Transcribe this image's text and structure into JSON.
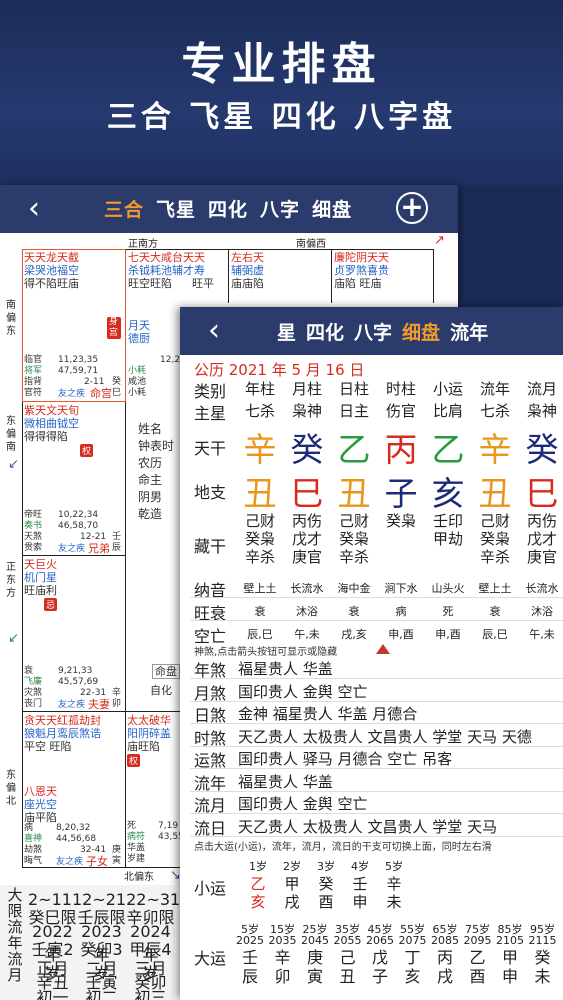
{
  "hero": {
    "title": "专业排盘",
    "subtitle": "三合 飞星 四化 八字盘"
  },
  "screen1": {
    "back": "‹",
    "tabs": [
      "三合",
      "飞星",
      "四化",
      "八字",
      "细盘"
    ],
    "plus": "+",
    "dirs": {
      "top_left": "正南方",
      "top_right": "南偏西",
      "left1": "南偏东",
      "left2": "东偏南",
      "left3": "正东方",
      "left4": "东偏北",
      "bottom": "北偏东"
    },
    "cell_a": {
      "stars_red": "天天龙天截",
      "stars_blue": "梁哭池福空",
      "status": "得不陷旺庙",
      "badge": "身宫",
      "r1": "临官",
      "r1n": "11,23,35",
      "r2": "将军",
      "r2n": "47,59,71",
      "r3": "指背",
      "r3n": "2-11",
      "r4": "官符",
      "r4n": "友之疾",
      "palace": "命宫",
      "gz": "癸巳"
    },
    "cell_b": {
      "stars_red": "七天大咸台天天",
      "stars_blue": "杀钺耗池辅才寿",
      "status": "旺空旺陷",
      "status2": "旺平",
      "mid1": "月天",
      "mid2": "德厨",
      "r1": "12,24",
      "r2": "小耗",
      "r3": "咸池",
      "r4": "小耗"
    },
    "cell_c": {
      "stars_red": "左右天",
      "stars_blue": "辅弼虚",
      "status": "庙庙陷"
    },
    "cell_d": {
      "stars_red": "廉陀阴天天",
      "stars_blue": "贞罗煞喜贵",
      "status": "庙陷  旺庙"
    },
    "cell_e": {
      "stars_red": "紫天文天旬",
      "stars_blue": "微相曲钺空",
      "status": "得得得陷",
      "badge": "权",
      "r1": "帝旺",
      "r1n": "10,22,34",
      "r2": "奏书",
      "r2n": "46,58,70",
      "r3": "天煞",
      "r3n": "12-21",
      "r4": "贯索",
      "r4n": "友之疾",
      "palace": "兄弟",
      "gz": "壬辰"
    },
    "cell_f": {
      "stars_red": "天巨火",
      "stars_blue": "机门星",
      "status": "旺庙利",
      "badge": "忌",
      "r1": "衰",
      "r1n": "9,21,33",
      "r2": "飞廉",
      "r2n": "45,57,69",
      "r3": "灾煞",
      "r3n": "22-31",
      "r4": "丧门",
      "r4n": "友之疾",
      "palace": "夫妻",
      "gz": "辛卯"
    },
    "cell_g": {
      "stars_red": "贪天天红孤劫封",
      "stars_blue": "狼魁月鸾辰煞诰",
      "status": "平空  旺陷"
    },
    "cell_h": {
      "stars_red": "太太破华",
      "stars_blue": "阳阴碎盖",
      "status": "庙旺陷",
      "badge": "权",
      "r1": "死",
      "r1n": "7,19",
      "r2": "病符",
      "r2n": "43,55",
      "r3": "华盖",
      "r4": "岁建"
    },
    "cell_i": {
      "stars_red": "八恩天",
      "stars_blue": "座光空",
      "status": "庙平陷",
      "r1": "病",
      "r1n": "8,20,32",
      "r2": "喜神",
      "r2n": "44,56,68",
      "r3": "劫煞",
      "r3n": "32-41",
      "r4": "晦气",
      "r4n": "友之疾",
      "palace": "子女",
      "gz": "庚寅"
    },
    "center": {
      "l1": "姓名",
      "l2": "钟表时",
      "l3": "农历",
      "l4": "命主",
      "l5": "阴男",
      "l6": "乾造",
      "l7": "命盘",
      "l8": "自化"
    },
    "bottom_label": [
      "大",
      "限",
      "流",
      "年",
      "流",
      "月"
    ],
    "bottom_rows": [
      [
        "2~11",
        "12~21",
        "22~31"
      ],
      [
        "癸巳限",
        "壬辰限",
        "辛卯限"
      ],
      [
        "2022年",
        "2023年",
        "2024年"
      ],
      [
        "壬寅2岁",
        "癸卯3岁",
        "甲辰4岁"
      ],
      [
        "正月",
        "二月",
        "三月"
      ],
      [
        "辛丑",
        "壬寅",
        "癸卯"
      ],
      [
        "初一",
        "初二",
        "初三"
      ]
    ]
  },
  "screen2": {
    "back": "‹",
    "tabs": [
      "星",
      "四化",
      "八字",
      "细盘",
      "流年"
    ],
    "date": "公历 2021 年 5 月 16 日",
    "header_row": {
      "label": "类别",
      "cols": [
        "年柱",
        "月柱",
        "日柱",
        "时柱",
        "小运",
        "流年",
        "流月"
      ]
    },
    "zhuxing_row": {
      "label": "主星",
      "cols": [
        "七杀",
        "枭神",
        "日主",
        "伤官",
        "比肩",
        "七杀",
        "枭神"
      ]
    },
    "tiangan": {
      "label": "天干",
      "chars": [
        "辛",
        "癸",
        "乙",
        "丙",
        "乙",
        "辛",
        "癸"
      ],
      "colors": [
        "#e8961c",
        "#1c2a7a",
        "#2a9a3e",
        "#d62b1e",
        "#2a9a3e",
        "#e8961c",
        "#1c2a7a"
      ]
    },
    "dizhi": {
      "label": "地支",
      "chars": [
        "丑",
        "巳",
        "丑",
        "子",
        "亥",
        "丑",
        "巳"
      ],
      "colors": [
        "#e8961c",
        "#d62b1e",
        "#e8961c",
        "#1c2a7a",
        "#1c2a7a",
        "#e8961c",
        "#d62b1e"
      ]
    },
    "canggan": {
      "label": "藏干",
      "cols": [
        [
          "己财",
          "癸枭",
          "辛杀"
        ],
        [
          "丙伤",
          "戊才",
          "庚官"
        ],
        [
          "己财",
          "癸枭",
          "辛杀"
        ],
        [
          "癸枭",
          "",
          ""
        ],
        [
          "壬印",
          "甲劫",
          ""
        ],
        [
          "己财",
          "癸枭",
          "辛杀"
        ],
        [
          "丙伤",
          "戊才",
          "庚官"
        ]
      ]
    },
    "nayin": {
      "label": "纳音",
      "cols": [
        "壁上土",
        "长流水",
        "海中金",
        "涧下水",
        "山头火",
        "壁上土",
        "长流水"
      ]
    },
    "wangshuai": {
      "label": "旺衰",
      "cols": [
        "衰",
        "沐浴",
        "衰",
        "病",
        "死",
        "衰",
        "沐浴"
      ]
    },
    "kongwang": {
      "label": "空亡",
      "cols": [
        "辰,巳",
        "午,未",
        "戌,亥",
        "申,酉",
        "申,酉",
        "辰,巳",
        "午,未"
      ]
    },
    "sha_note": "神煞,点击箭头按钮可显示或隐藏",
    "sha": [
      {
        "label": "年煞",
        "value": "福星贵人 华盖"
      },
      {
        "label": "月煞",
        "value": "国印贵人 金舆 空亡"
      },
      {
        "label": "日煞",
        "value": "金神 福星贵人 华盖 月德合"
      },
      {
        "label": "时煞",
        "value": "天乙贵人 太极贵人 文昌贵人 学堂 天马 天德"
      },
      {
        "label": "运煞",
        "value": "国印贵人 驿马 月德合 空亡 吊客"
      },
      {
        "label": "流年",
        "value": "福星贵人 华盖"
      },
      {
        "label": "流月",
        "value": "国印贵人 金舆 空亡"
      },
      {
        "label": "流日",
        "value": "天乙贵人 太极贵人 文昌贵人 学堂 天马"
      }
    ],
    "switch_note": "点击大运(小运)，流年，流月，流日的干支可切换上面，同时左右滑",
    "xiaoyun": {
      "label": "小运",
      "ages": [
        "1岁",
        "2岁",
        "3岁",
        "4岁",
        "5岁"
      ],
      "gan": [
        "乙",
        "甲",
        "癸",
        "壬",
        "辛"
      ],
      "zhi": [
        "亥",
        "戌",
        "酉",
        "申",
        "未"
      ]
    },
    "dayun": {
      "label": "大运",
      "ages": [
        "5岁",
        "15岁",
        "25岁",
        "35岁",
        "45岁",
        "55岁",
        "65岁",
        "75岁",
        "85岁",
        "95岁"
      ],
      "years": [
        "2025",
        "2035",
        "2045",
        "2055",
        "2065",
        "2075",
        "2085",
        "2095",
        "2105",
        "2115"
      ],
      "gan": [
        "壬",
        "辛",
        "庚",
        "己",
        "戊",
        "丁",
        "丙",
        "乙",
        "甲",
        "癸"
      ],
      "zhi": [
        "辰",
        "卯",
        "寅",
        "丑",
        "子",
        "亥",
        "戌",
        "酉",
        "申",
        "未"
      ]
    }
  }
}
